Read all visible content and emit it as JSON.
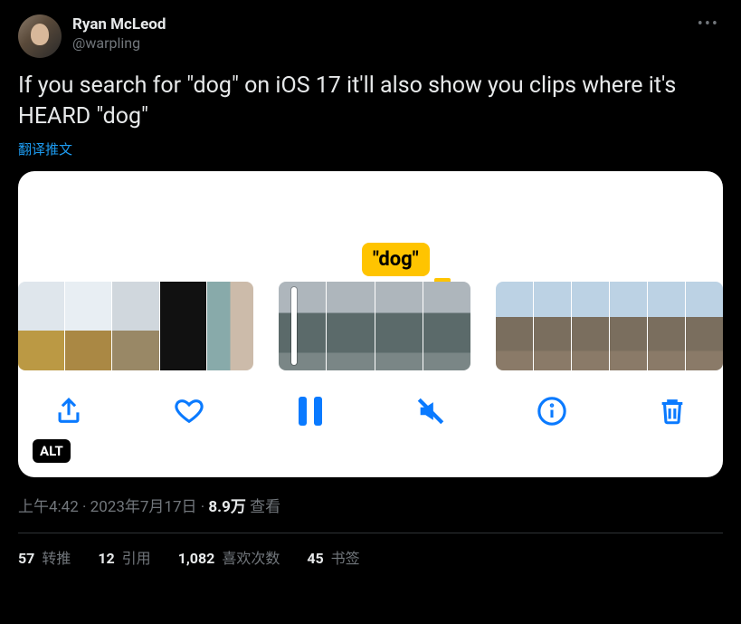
{
  "user": {
    "display_name": "Ryan McLeod",
    "handle": "@warpling"
  },
  "tweet_text": "If you search for \"dog\" on iOS 17 it'll also show you clips where it's HEARD \"dog\"",
  "translate_label": "翻译推文",
  "media": {
    "caption": "\"dog\"",
    "alt_badge": "ALT"
  },
  "meta": {
    "time": "上午4:42",
    "dot1": " · ",
    "date": "2023年7月17日",
    "dot2": " · ",
    "views_count": "8.9万",
    "views_label": " 查看"
  },
  "stats": {
    "retweets": {
      "num": "57",
      "label": " 转推"
    },
    "quotes": {
      "num": "12",
      "label": " 引用"
    },
    "likes": {
      "num": "1,082",
      "label": " 喜欢次数"
    },
    "bookmarks": {
      "num": "45",
      "label": " 书签"
    }
  }
}
